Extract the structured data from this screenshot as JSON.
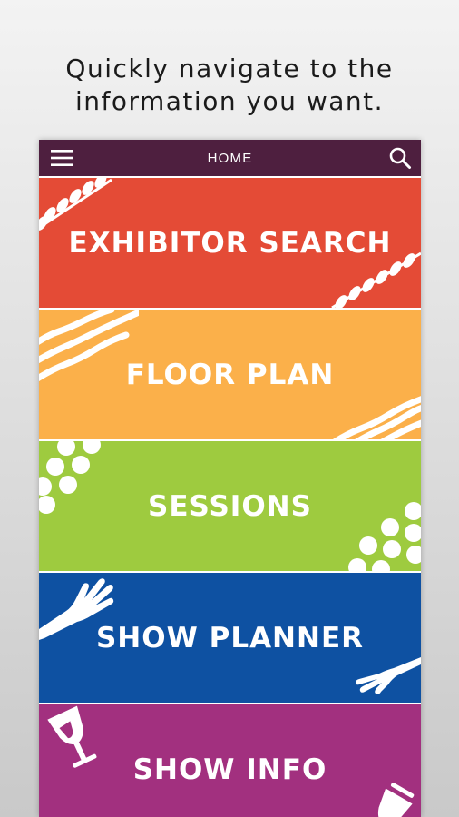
{
  "caption": {
    "line1": "Quickly navigate to the",
    "line2": "information you want."
  },
  "topbar": {
    "title": "HOME",
    "menu_icon": "hamburger-menu-icon",
    "search_icon": "search-icon"
  },
  "tiles": [
    {
      "label": "EXHIBITOR SEARCH",
      "color": "#e44b36",
      "icon": "zigzag-stitch-pattern"
    },
    {
      "label": "FLOOR PLAN",
      "color": "#fbb04a",
      "icon": "wavy-lines-pattern"
    },
    {
      "label": "SESSIONS",
      "color": "#9ecb3f",
      "icon": "dots-pattern"
    },
    {
      "label": "SHOW PLANNER",
      "color": "#0e51a2",
      "icon": "hand-icon"
    },
    {
      "label": "SHOW INFO",
      "color": "#a2307f",
      "icon": "wine-glass-icon"
    }
  ]
}
